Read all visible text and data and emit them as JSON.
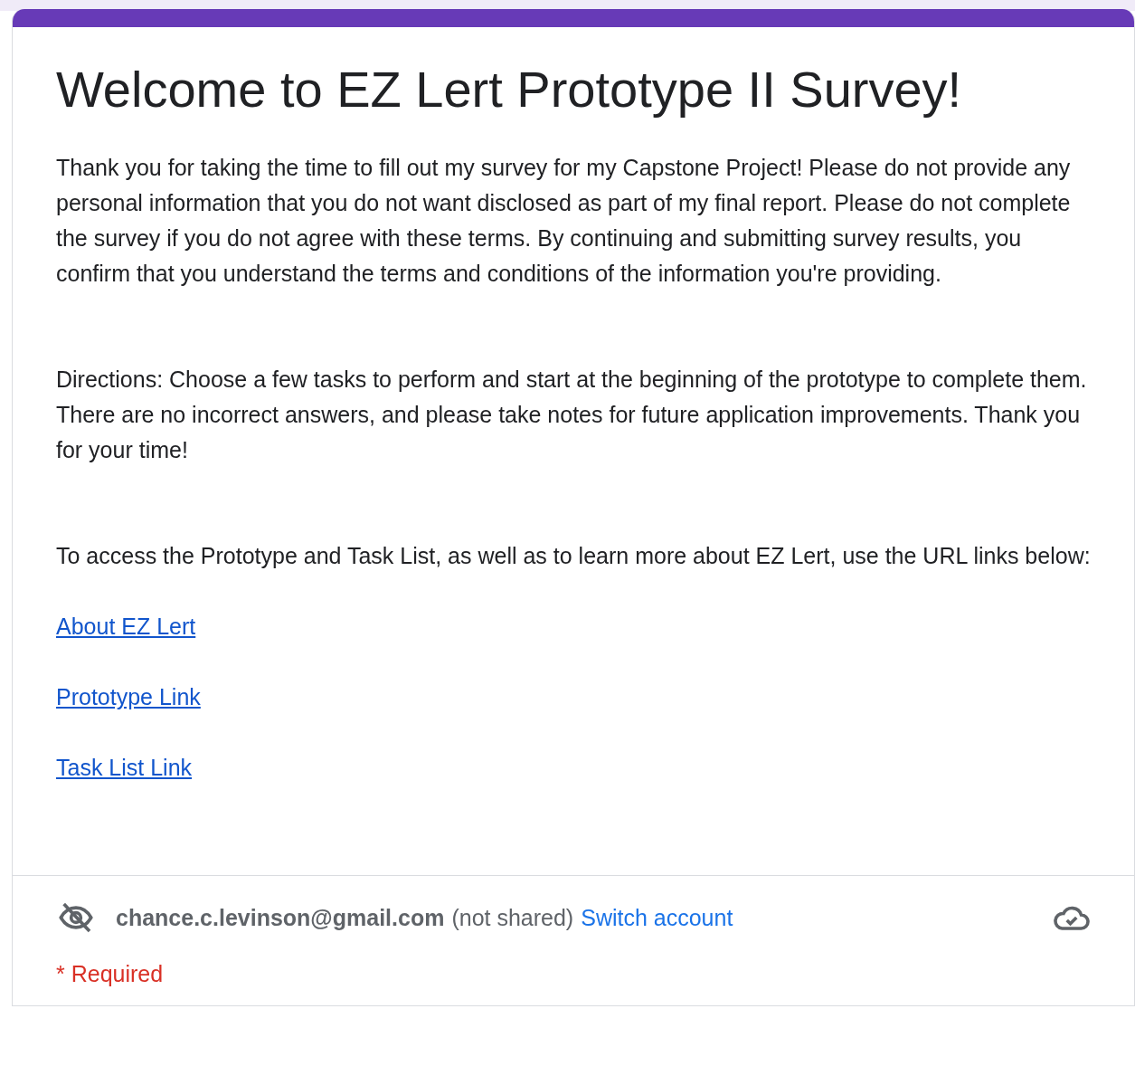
{
  "form": {
    "title": "Welcome to EZ Lert Prototype II Survey!",
    "paragraphs": [
      "Thank you for taking the time to fill out my survey for my Capstone Project! Please do not provide any personal information that you do not want disclosed as part of my final report. Please do not complete the survey if you do not agree with these terms. By continuing and submitting survey results, you confirm that you understand the terms and conditions of the information you're providing.",
      "Directions: Choose a few tasks to perform and start at the beginning of the prototype to complete them. There are no incorrect answers, and please take notes for future application improvements. Thank you for your time!",
      "To access the Prototype and Task List, as well as to learn more about EZ Lert, use the URL links below:"
    ],
    "links": [
      "About EZ Lert",
      "Prototype Link",
      "Task List Link"
    ]
  },
  "account": {
    "email": "chance.c.levinson@gmail.com",
    "note": "(not shared)",
    "switch": "Switch account"
  },
  "required": "* Required"
}
